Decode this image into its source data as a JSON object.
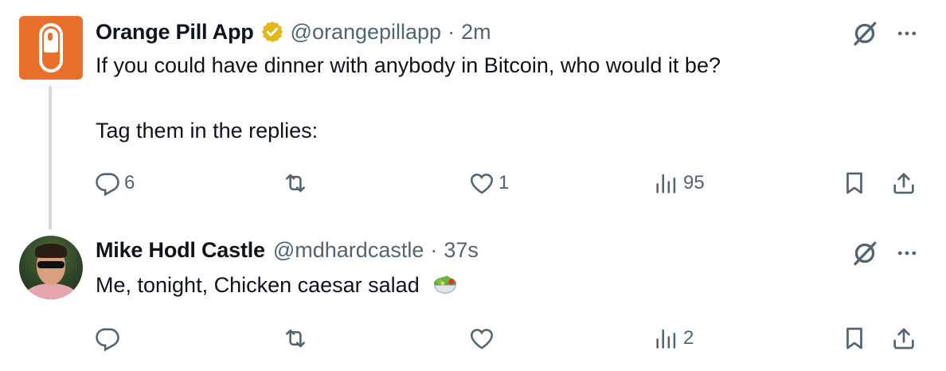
{
  "tweets": [
    {
      "name": "Orange Pill App",
      "handle": "@orangepillapp",
      "separator": "·",
      "time": "2m",
      "lines": [
        "If you could have dinner with anybody in Bitcoin, who would it be?",
        "Tag them in the replies:"
      ],
      "stats": {
        "replies": "6",
        "retweets": "",
        "likes": "1",
        "views": "95"
      },
      "verified": true,
      "avatar_icon": "orange-pill-logo",
      "accent": "#e8702a"
    },
    {
      "name": "Mike Hodl Castle",
      "handle": "@mdhardcastle",
      "separator": "·",
      "time": "37s",
      "lines": [
        "Me, tonight, Chicken caesar salad"
      ],
      "stats": {
        "replies": "",
        "retweets": "",
        "likes": "",
        "views": "2"
      },
      "verified": false,
      "avatar_icon": "user-photo",
      "emoji": "salad-emoji"
    }
  ],
  "icons": {
    "grok": "grok-icon",
    "more": "more-icon",
    "reply": "reply-icon",
    "retweet": "retweet-icon",
    "like": "heart-icon",
    "views": "views-icon",
    "bookmark": "bookmark-icon",
    "share": "share-icon",
    "verified": "verified-badge-icon"
  },
  "colors": {
    "text": "#0f1419",
    "secondary": "#536471",
    "verified_gold": "#e2b719",
    "thread_line": "#cfd9de"
  }
}
